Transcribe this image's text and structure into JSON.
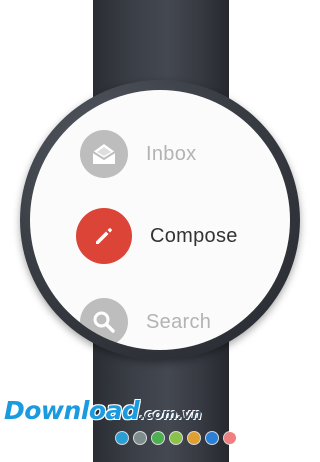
{
  "colors": {
    "screen_background": "#fbfbfb",
    "inactive_icon_bg": "#bdbdbd",
    "inactive_label": "#b3b3b3",
    "compose_icon_bg": "#db4437",
    "compose_label": "#333333",
    "icon_glyph": "#ffffff",
    "watermark_blue": "#1a9be0",
    "watermark_dark": "#3b4a5a"
  },
  "menu": {
    "items": [
      {
        "label": "Inbox",
        "icon": "inbox-icon",
        "state": "inactive"
      },
      {
        "label": "Compose",
        "icon": "pencil-icon",
        "state": "selected"
      },
      {
        "label": "Search",
        "icon": "search-icon",
        "state": "inactive"
      }
    ]
  },
  "watermark": {
    "main": "Download",
    "tld": ".com.vn",
    "dot_colors": [
      "#2a9fd6",
      "#7f8c8d",
      "#4caf50",
      "#8bc34a",
      "#e0a030",
      "#2a7fd6",
      "#f08080"
    ]
  }
}
